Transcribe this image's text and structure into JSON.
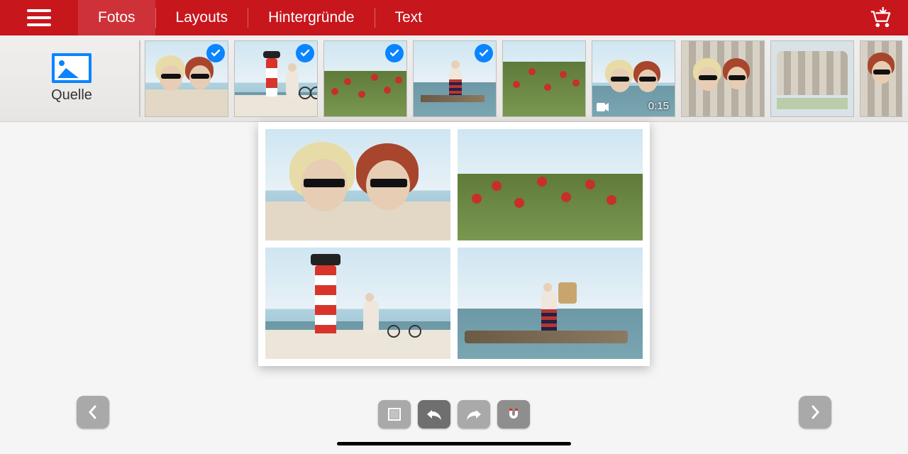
{
  "colors": {
    "brand": "#c8161d",
    "accent": "#0a84ff"
  },
  "topbar": {
    "tabs": [
      {
        "id": "fotos",
        "label": "Fotos",
        "active": true
      },
      {
        "id": "layouts",
        "label": "Layouts",
        "active": false
      },
      {
        "id": "hintergruende",
        "label": "Hintergründe",
        "active": false
      },
      {
        "id": "text",
        "label": "Text",
        "active": false
      }
    ],
    "cart_icon": "cart-download-icon",
    "menu_icon": "hamburger-icon"
  },
  "strip": {
    "source_label": "Quelle",
    "source_icon": "image-source-icon",
    "thumbs": [
      {
        "id": "t1",
        "kind": "selfie-two-people-beach",
        "selected": true,
        "is_video": false
      },
      {
        "id": "t2",
        "kind": "lighthouse-bike",
        "selected": true,
        "is_video": false
      },
      {
        "id": "t3",
        "kind": "poppy-field",
        "selected": true,
        "is_video": false
      },
      {
        "id": "t4",
        "kind": "woman-breakwater",
        "selected": true,
        "is_video": false
      },
      {
        "id": "t5",
        "kind": "poppy-field-tall",
        "selected": false,
        "is_video": false
      },
      {
        "id": "t6",
        "kind": "selfie-two-people-sea",
        "selected": false,
        "is_video": true,
        "duration": "0:15"
      },
      {
        "id": "t7",
        "kind": "selfie-two-people-cabana",
        "selected": false,
        "is_video": false
      },
      {
        "id": "t8",
        "kind": "beach-cabana",
        "selected": false,
        "is_video": false
      },
      {
        "id": "t9",
        "kind": "woman-cabana-portrait",
        "selected": false,
        "is_video": false
      }
    ]
  },
  "page": {
    "cells": [
      {
        "slot": 0,
        "content": "selfie-two-people-beach"
      },
      {
        "slot": 1,
        "content": "poppy-field"
      },
      {
        "slot": 2,
        "content": "lighthouse-bike"
      },
      {
        "slot": 3,
        "content": "woman-breakwater"
      }
    ]
  },
  "tools": {
    "crop_icon": "crop-icon",
    "undo_icon": "undo-icon",
    "redo_icon": "redo-icon",
    "magnet_icon": "magnet-icon"
  },
  "nav": {
    "prev_icon": "chevron-left-icon",
    "next_icon": "chevron-right-icon"
  }
}
